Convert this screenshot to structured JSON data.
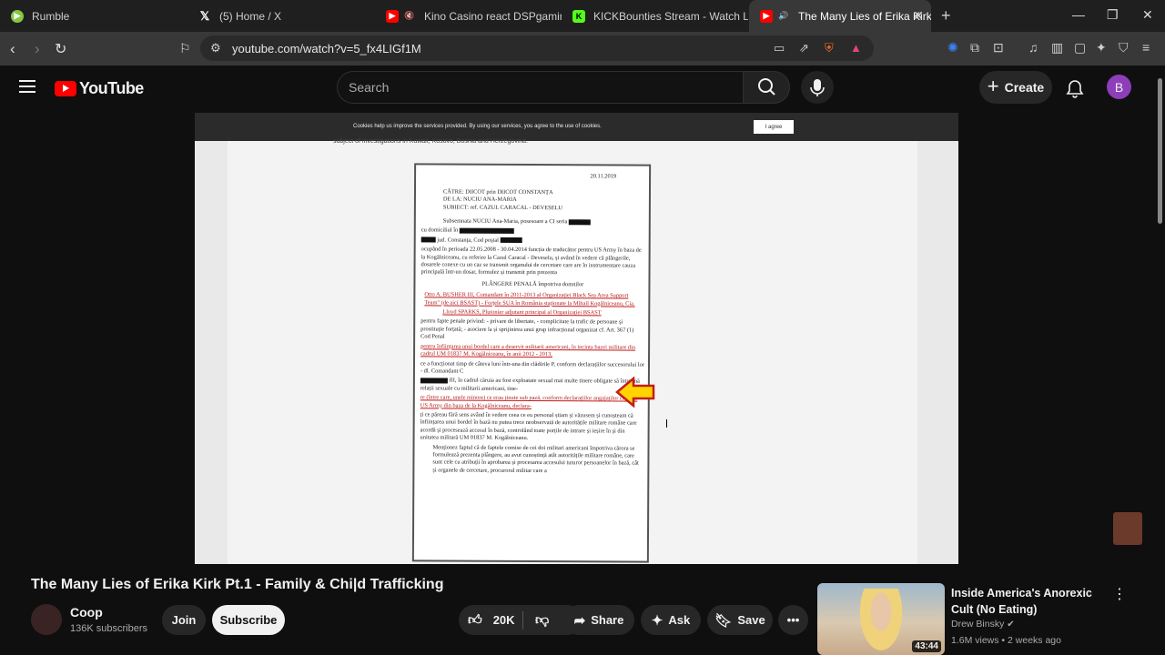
{
  "browser": {
    "tabs": [
      {
        "title": "Rumble",
        "favicon_color": "#85c742"
      },
      {
        "title": "(5) Home / X",
        "favicon_color": "#000000"
      },
      {
        "title": "Kino Casino react DSPgamings W",
        "favicon_color": "#ff0000"
      },
      {
        "title": "KICKBounties Stream - Watch Live on",
        "favicon_color": "#53fc18"
      },
      {
        "title": "The Many Lies of Erika Kirk Pt",
        "favicon_color": "#ff0000"
      }
    ],
    "url": "youtube.com/watch?v=5_fx4LIGf1M"
  },
  "youtube": {
    "logo_text": "YouTube",
    "search_placeholder": "Search",
    "create_label": "Create",
    "avatar_initial": "B",
    "accent": "#ff0000"
  },
  "video_frame": {
    "cookie_text": "Cookies help us improve the services provided. By using our services, you agree to the use of cookies.",
    "cookie_button": "I agree",
    "caption_top": "subject of investigations in Kuwait, Kosovo, Bosnia and Herzegovina.",
    "doc_date": "20.11.2019",
    "doc_header": [
      "CĂTRE:   DIICOT prin DIICOT CONSTANȚA",
      "DE LA:   NUCIU ANA-MARIA",
      "SUBIECT:  ref. CAZUL CARACAL - DEVESELU"
    ],
    "doc_para1": "Subsemnata NUCIU Ana-Maria, posesoare a CI seria",
    "doc_para2": "cu domiciliul în",
    "doc_para3": "jud. Constanța, Cod poștal",
    "doc_para4": "ocupând în perioada 22.05.2008 - 30.04.2014 funcția de traducător pentru US Army în baza de la Kogălniceanu, cu referire la Cazul Caracal - Deveselu, și având în vedere că plângerile, dosarele conexe cu un caz se transmit organului de cercetare care are în instrumentare cauza principală într-un dosar, formulez și transmit prin prezenta",
    "doc_title": "PLÂNGERE PENALĂ împotriva domnilor",
    "doc_red1": "Otto A. BUSHER III, Comandant în 2011-2013 al Organizației Black Sea Area Support Team\" (de aici BSAST) - Forțele SUA în România staționate la Mihail Kogălniceanu, Cia.",
    "doc_red2": "Lloyd SPARKS, Plutonier adjutant principal al Organizației BSAST",
    "doc_list": "pentru fapte penale privind: - privare de libertate, - complicitate la trafic de persoane și prostituție forțată; - asociere la și sprijinirea unui grup infracțional organizat cf. Art. 367 (1) Cod Penal",
    "doc_red3": "pentru înființarea unui bordel care a deservit militarii americani, în incinta bazei militare din cadrul UM 01837 M. Kogălniceanu, în anii 2012 - 2013,",
    "doc_para5": "ce a funcționat timp de câteva luni într-una din clădirile P, conform declarațiilor succesorului lor - dl. Comandant C",
    "doc_para6": "III, în cadrul căruia au fost exploatate sexual mai multe tinere obligate să întrețină relații sexuale cu militarii americani, tine-",
    "doc_red4": "re (între care, unele minore) ce erau ținute sub pază, conform declarațiilor angajaților civili ai US Army din baza de la Kogălniceanu, declara-",
    "doc_para7": "ți ce păreau fără sens având în vedere ceea ce eu personal știam și văzusem și cunoșteam că înființarea unui bordel în bază nu putea trece neobservată de autoritățile militare române care acordă și procesează accesul în bază, controlând toate porțile de intrare și ieșire în și din unitatea militară UM 01837 M. Kogălniceanu.",
    "doc_para8": "Menționez faptul că de faptele comise de cei doi militari americani împotriva cărora se formulează prezenta plângere, au avut cunoștință atât autoritățile militare române, care sunt cele cu atribuții în aprobarea și procesarea accesului tuturor persoanelor în bază, cât și organele de cercetare, procurorul militar care a"
  },
  "video": {
    "title": "The Many Lies of Erika Kirk Pt.1 - Family & Chi|d Trafficking",
    "channel": "Coop",
    "subscribers": "136K subscribers",
    "join_label": "Join",
    "subscribe_label": "Subscribe",
    "likes": "20K",
    "share_label": "Share",
    "ask_label": "Ask",
    "save_label": "Save"
  },
  "recommendation": {
    "title": "Inside America's Anorexic Cult (No Eating)",
    "channel": "Drew Binsky",
    "meta": "1.6M views • 2 weeks ago",
    "duration": "43:44"
  }
}
